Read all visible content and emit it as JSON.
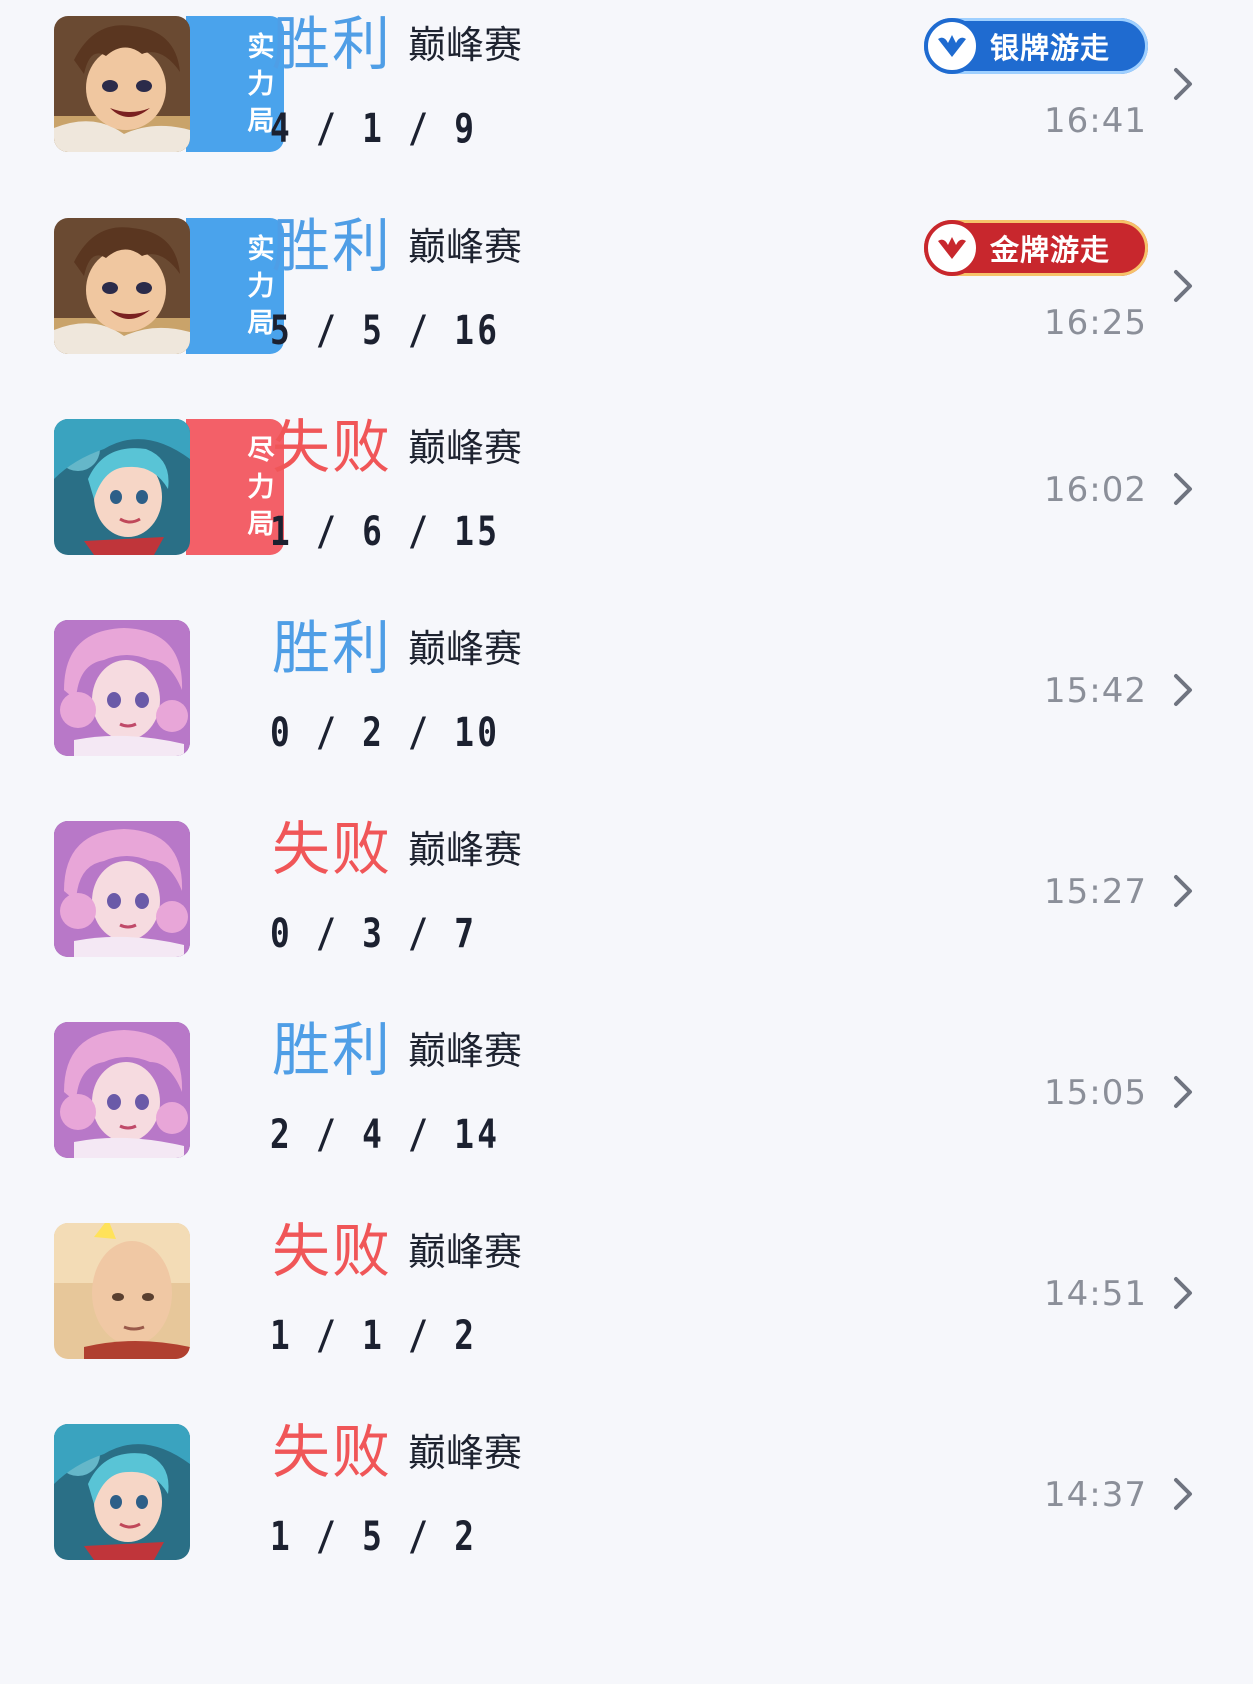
{
  "colors": {
    "win": "#4f9ee6",
    "loss": "#f05658",
    "tag_strength": "#4aa3ec",
    "tag_effort": "#f36068",
    "silver_badge": "#1f6bd0",
    "gold_badge": "#c8272d"
  },
  "matches": [
    {
      "hero_icon": "brown-hair-boy-hero-icon",
      "tag": [
        "实",
        "力",
        "局"
      ],
      "tag_type": "strength",
      "result": "胜利",
      "outcome": "win",
      "mode": "巅峰赛",
      "kda": "4 / 1 / 9",
      "badge": "银牌游走",
      "badge_type": "silver",
      "time": "16:41"
    },
    {
      "hero_icon": "brown-hair-boy-hero-icon",
      "tag": [
        "实",
        "力",
        "局"
      ],
      "tag_type": "strength",
      "result": "胜利",
      "outcome": "win",
      "mode": "巅峰赛",
      "kda": "5 / 5 / 16",
      "badge": "金牌游走",
      "badge_type": "gold",
      "time": "16:25"
    },
    {
      "hero_icon": "teal-hair-girl-hero-icon",
      "tag": [
        "尽",
        "力",
        "局"
      ],
      "tag_type": "effort",
      "result": "失败",
      "outcome": "loss",
      "mode": "巅峰赛",
      "kda": "1 / 6 / 15",
      "badge": "",
      "badge_type": "",
      "time": "16:02"
    },
    {
      "hero_icon": "pink-hair-girl-hero-icon",
      "tag": [],
      "tag_type": "",
      "result": "胜利",
      "outcome": "win",
      "mode": "巅峰赛",
      "kda": "0 / 2 / 10",
      "badge": "",
      "badge_type": "",
      "time": "15:42"
    },
    {
      "hero_icon": "pink-hair-girl-hero-icon",
      "tag": [],
      "tag_type": "",
      "result": "失败",
      "outcome": "loss",
      "mode": "巅峰赛",
      "kda": "0 / 3 / 7",
      "badge": "",
      "badge_type": "",
      "time": "15:27"
    },
    {
      "hero_icon": "pink-hair-girl-hero-icon",
      "tag": [],
      "tag_type": "",
      "result": "胜利",
      "outcome": "win",
      "mode": "巅峰赛",
      "kda": "2 / 4 / 14",
      "badge": "",
      "badge_type": "",
      "time": "15:05"
    },
    {
      "hero_icon": "bald-man-hero-icon",
      "tag": [],
      "tag_type": "",
      "result": "失败",
      "outcome": "loss",
      "mode": "巅峰赛",
      "kda": "1 / 1 / 2",
      "badge": "",
      "badge_type": "",
      "time": "14:51"
    },
    {
      "hero_icon": "teal-hair-girl-hero-icon",
      "tag": [],
      "tag_type": "",
      "result": "失败",
      "outcome": "loss",
      "mode": "巅峰赛",
      "kda": "1 / 5 / 2",
      "badge": "",
      "badge_type": "",
      "time": "14:37"
    }
  ]
}
